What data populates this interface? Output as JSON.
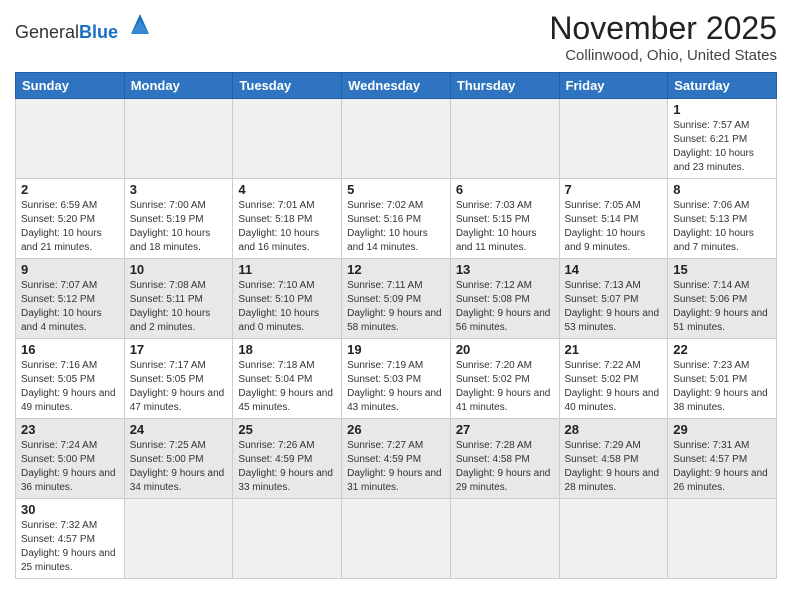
{
  "header": {
    "logo_general": "General",
    "logo_blue": "Blue",
    "month_title": "November 2025",
    "location": "Collinwood, Ohio, United States"
  },
  "days_of_week": [
    "Sunday",
    "Monday",
    "Tuesday",
    "Wednesday",
    "Thursday",
    "Friday",
    "Saturday"
  ],
  "weeks": [
    {
      "shaded": false,
      "days": [
        {
          "num": "",
          "info": "",
          "empty": true
        },
        {
          "num": "",
          "info": "",
          "empty": true
        },
        {
          "num": "",
          "info": "",
          "empty": true
        },
        {
          "num": "",
          "info": "",
          "empty": true
        },
        {
          "num": "",
          "info": "",
          "empty": true
        },
        {
          "num": "",
          "info": "",
          "empty": true
        },
        {
          "num": "1",
          "info": "Sunrise: 7:57 AM\nSunset: 6:21 PM\nDaylight: 10 hours\nand 23 minutes.",
          "empty": false
        }
      ]
    },
    {
      "shaded": false,
      "days": [
        {
          "num": "2",
          "info": "Sunrise: 6:59 AM\nSunset: 5:20 PM\nDaylight: 10 hours\nand 21 minutes.",
          "empty": false
        },
        {
          "num": "3",
          "info": "Sunrise: 7:00 AM\nSunset: 5:19 PM\nDaylight: 10 hours\nand 18 minutes.",
          "empty": false
        },
        {
          "num": "4",
          "info": "Sunrise: 7:01 AM\nSunset: 5:18 PM\nDaylight: 10 hours\nand 16 minutes.",
          "empty": false
        },
        {
          "num": "5",
          "info": "Sunrise: 7:02 AM\nSunset: 5:16 PM\nDaylight: 10 hours\nand 14 minutes.",
          "empty": false
        },
        {
          "num": "6",
          "info": "Sunrise: 7:03 AM\nSunset: 5:15 PM\nDaylight: 10 hours\nand 11 minutes.",
          "empty": false
        },
        {
          "num": "7",
          "info": "Sunrise: 7:05 AM\nSunset: 5:14 PM\nDaylight: 10 hours\nand 9 minutes.",
          "empty": false
        },
        {
          "num": "8",
          "info": "Sunrise: 7:06 AM\nSunset: 5:13 PM\nDaylight: 10 hours\nand 7 minutes.",
          "empty": false
        }
      ]
    },
    {
      "shaded": true,
      "days": [
        {
          "num": "9",
          "info": "Sunrise: 7:07 AM\nSunset: 5:12 PM\nDaylight: 10 hours\nand 4 minutes.",
          "empty": false
        },
        {
          "num": "10",
          "info": "Sunrise: 7:08 AM\nSunset: 5:11 PM\nDaylight: 10 hours\nand 2 minutes.",
          "empty": false
        },
        {
          "num": "11",
          "info": "Sunrise: 7:10 AM\nSunset: 5:10 PM\nDaylight: 10 hours\nand 0 minutes.",
          "empty": false
        },
        {
          "num": "12",
          "info": "Sunrise: 7:11 AM\nSunset: 5:09 PM\nDaylight: 9 hours\nand 58 minutes.",
          "empty": false
        },
        {
          "num": "13",
          "info": "Sunrise: 7:12 AM\nSunset: 5:08 PM\nDaylight: 9 hours\nand 56 minutes.",
          "empty": false
        },
        {
          "num": "14",
          "info": "Sunrise: 7:13 AM\nSunset: 5:07 PM\nDaylight: 9 hours\nand 53 minutes.",
          "empty": false
        },
        {
          "num": "15",
          "info": "Sunrise: 7:14 AM\nSunset: 5:06 PM\nDaylight: 9 hours\nand 51 minutes.",
          "empty": false
        }
      ]
    },
    {
      "shaded": false,
      "days": [
        {
          "num": "16",
          "info": "Sunrise: 7:16 AM\nSunset: 5:05 PM\nDaylight: 9 hours\nand 49 minutes.",
          "empty": false
        },
        {
          "num": "17",
          "info": "Sunrise: 7:17 AM\nSunset: 5:05 PM\nDaylight: 9 hours\nand 47 minutes.",
          "empty": false
        },
        {
          "num": "18",
          "info": "Sunrise: 7:18 AM\nSunset: 5:04 PM\nDaylight: 9 hours\nand 45 minutes.",
          "empty": false
        },
        {
          "num": "19",
          "info": "Sunrise: 7:19 AM\nSunset: 5:03 PM\nDaylight: 9 hours\nand 43 minutes.",
          "empty": false
        },
        {
          "num": "20",
          "info": "Sunrise: 7:20 AM\nSunset: 5:02 PM\nDaylight: 9 hours\nand 41 minutes.",
          "empty": false
        },
        {
          "num": "21",
          "info": "Sunrise: 7:22 AM\nSunset: 5:02 PM\nDaylight: 9 hours\nand 40 minutes.",
          "empty": false
        },
        {
          "num": "22",
          "info": "Sunrise: 7:23 AM\nSunset: 5:01 PM\nDaylight: 9 hours\nand 38 minutes.",
          "empty": false
        }
      ]
    },
    {
      "shaded": true,
      "days": [
        {
          "num": "23",
          "info": "Sunrise: 7:24 AM\nSunset: 5:00 PM\nDaylight: 9 hours\nand 36 minutes.",
          "empty": false
        },
        {
          "num": "24",
          "info": "Sunrise: 7:25 AM\nSunset: 5:00 PM\nDaylight: 9 hours\nand 34 minutes.",
          "empty": false
        },
        {
          "num": "25",
          "info": "Sunrise: 7:26 AM\nSunset: 4:59 PM\nDaylight: 9 hours\nand 33 minutes.",
          "empty": false
        },
        {
          "num": "26",
          "info": "Sunrise: 7:27 AM\nSunset: 4:59 PM\nDaylight: 9 hours\nand 31 minutes.",
          "empty": false
        },
        {
          "num": "27",
          "info": "Sunrise: 7:28 AM\nSunset: 4:58 PM\nDaylight: 9 hours\nand 29 minutes.",
          "empty": false
        },
        {
          "num": "28",
          "info": "Sunrise: 7:29 AM\nSunset: 4:58 PM\nDaylight: 9 hours\nand 28 minutes.",
          "empty": false
        },
        {
          "num": "29",
          "info": "Sunrise: 7:31 AM\nSunset: 4:57 PM\nDaylight: 9 hours\nand 26 minutes.",
          "empty": false
        }
      ]
    },
    {
      "shaded": false,
      "days": [
        {
          "num": "30",
          "info": "Sunrise: 7:32 AM\nSunset: 4:57 PM\nDaylight: 9 hours\nand 25 minutes.",
          "empty": false
        },
        {
          "num": "",
          "info": "",
          "empty": true
        },
        {
          "num": "",
          "info": "",
          "empty": true
        },
        {
          "num": "",
          "info": "",
          "empty": true
        },
        {
          "num": "",
          "info": "",
          "empty": true
        },
        {
          "num": "",
          "info": "",
          "empty": true
        },
        {
          "num": "",
          "info": "",
          "empty": true
        }
      ]
    }
  ]
}
